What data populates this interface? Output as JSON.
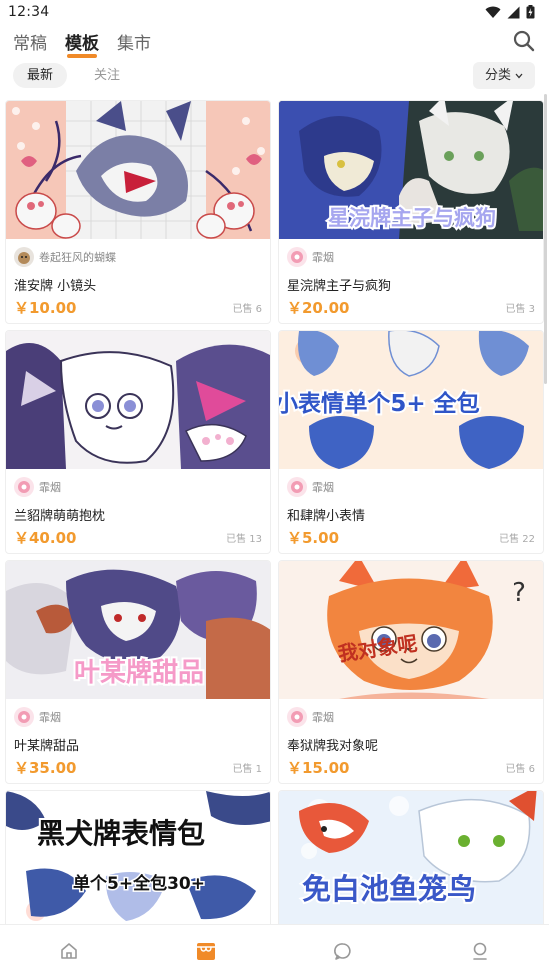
{
  "status": {
    "time": "12:34"
  },
  "top_tabs": [
    {
      "label": "常稿",
      "active": false
    },
    {
      "label": "模板",
      "active": true
    },
    {
      "label": "集市",
      "active": false
    }
  ],
  "filters": {
    "latest": "最新",
    "follow": "关注",
    "sort": "分类"
  },
  "cards": [
    {
      "author": "卷起狂风的蝴蝶",
      "title": "淮安牌 小镜头",
      "price": "￥10.00",
      "sold": "已售 6",
      "overlay": ""
    },
    {
      "author": "霏烟",
      "title": "星浣牌主子与疯狗",
      "price": "￥20.00",
      "sold": "已售 3",
      "overlay": "星浣牌主子与疯狗"
    },
    {
      "author": "霏烟",
      "title": "兰貂牌萌萌抱枕",
      "price": "￥40.00",
      "sold": "已售 13",
      "overlay": ""
    },
    {
      "author": "霏烟",
      "title": "和肆牌小表情",
      "price": "￥5.00",
      "sold": "已售 22",
      "overlay": "单个5+ 全包"
    },
    {
      "author": "霏烟",
      "title": "叶某牌甜品",
      "price": "￥35.00",
      "sold": "已售 1",
      "overlay": "叶某牌甜品"
    },
    {
      "author": "霏烟",
      "title": "奉狱牌我对象呢",
      "price": "￥15.00",
      "sold": "已售 6",
      "overlay": "我对象呢"
    },
    {
      "author": "",
      "title": "",
      "price": "",
      "sold": "",
      "overlay": "黑犬牌表情包"
    },
    {
      "author": "",
      "title": "",
      "price": "",
      "sold": "",
      "overlay": "免白池鱼笼鸟"
    }
  ],
  "card7_sub": "单个5+全包30+",
  "colors": {
    "accent": "#f08a28",
    "price": "#f29a2e"
  },
  "nav": [
    {
      "icon": "home-icon"
    },
    {
      "icon": "shop-icon",
      "active": true
    },
    {
      "icon": "message-icon"
    },
    {
      "icon": "profile-icon"
    }
  ]
}
